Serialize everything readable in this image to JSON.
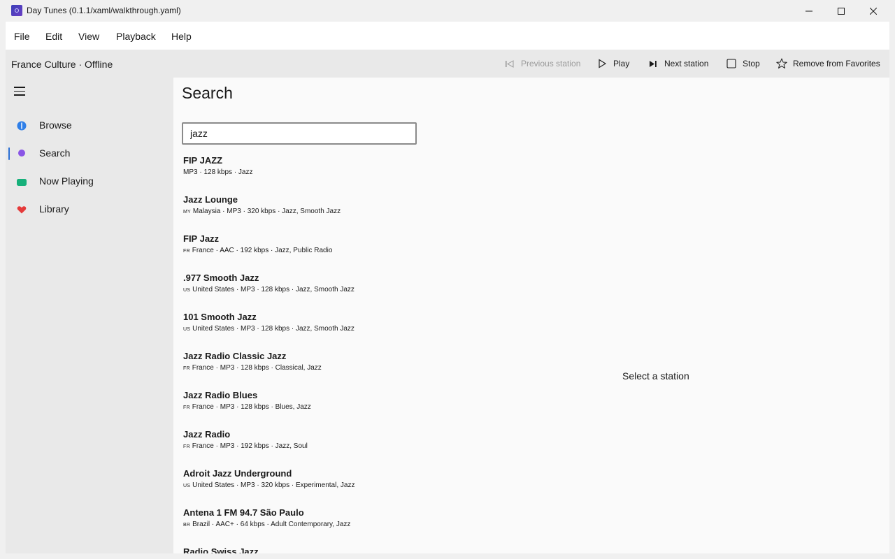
{
  "window": {
    "title": "Day Tunes (0.1.1/xaml/walkthrough.yaml)"
  },
  "menu": [
    "File",
    "Edit",
    "View",
    "Playback",
    "Help"
  ],
  "status": "France Culture · Offline",
  "toolbar": {
    "previous": "Previous station",
    "play": "Play",
    "next": "Next station",
    "stop": "Stop",
    "favorite": "Remove from Favorites"
  },
  "nav": [
    {
      "label": "Browse",
      "icon": "browse-icon",
      "color": "#2f7fe8"
    },
    {
      "label": "Search",
      "icon": "search-dot-icon",
      "color": "#8a55e6",
      "selected": true
    },
    {
      "label": "Now Playing",
      "icon": "now-playing-icon",
      "color": "#16b07a"
    },
    {
      "label": "Library",
      "icon": "heart-icon",
      "color": "#e53a3a"
    }
  ],
  "page": {
    "title": "Search"
  },
  "search": {
    "value": "jazz"
  },
  "results": [
    {
      "name": "FIP JAZZ",
      "country": "",
      "meta": "MP3 · 128 kbps · Jazz"
    },
    {
      "name": "Jazz Lounge",
      "country": "MY",
      "meta": "Malaysia · MP3 · 320 kbps · Jazz, Smooth Jazz"
    },
    {
      "name": "FIP Jazz",
      "country": "FR",
      "meta": "France · AAC · 192 kbps · Jazz, Public Radio"
    },
    {
      "name": ".977 Smooth Jazz",
      "country": "US",
      "meta": "United States · MP3 · 128 kbps · Jazz, Smooth Jazz"
    },
    {
      "name": "101 Smooth Jazz",
      "country": "US",
      "meta": "United States · MP3 · 128 kbps · Jazz, Smooth Jazz"
    },
    {
      "name": "Jazz Radio Classic Jazz",
      "country": "FR",
      "meta": "France · MP3 · 128 kbps · Classical, Jazz"
    },
    {
      "name": "Jazz Radio Blues",
      "country": "FR",
      "meta": "France · MP3 · 128 kbps · Blues, Jazz"
    },
    {
      "name": "Jazz Radio",
      "country": "FR",
      "meta": "France · MP3 · 192 kbps · Jazz, Soul"
    },
    {
      "name": "Adroit Jazz Underground",
      "country": "US",
      "meta": "United States · MP3 · 320 kbps · Experimental, Jazz"
    },
    {
      "name": "Antena 1 FM 94.7 São Paulo",
      "country": "BR",
      "meta": "Brazil · AAC+ · 64 kbps · Adult Contemporary, Jazz"
    },
    {
      "name": "Radio Swiss Jazz",
      "country": "",
      "meta": ""
    }
  ],
  "detail": {
    "placeholder": "Select a station"
  }
}
